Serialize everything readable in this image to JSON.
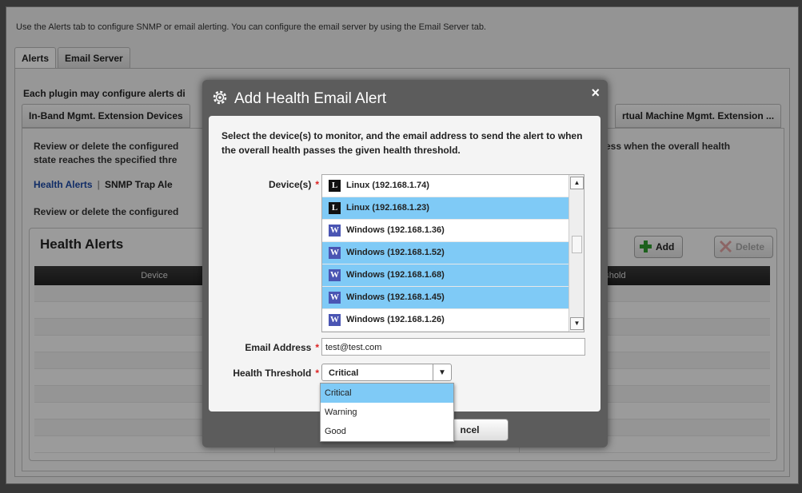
{
  "intro_text": "Use the Alerts tab to configure SNMP or email alerting.  You can configure the email server by using the Email Server tab.",
  "outer_tabs": [
    {
      "label": "Alerts"
    },
    {
      "label": "Email Server"
    }
  ],
  "plugin_text": "Each plugin may configure alerts di",
  "inner_tabs": [
    {
      "label": "In-Band Mgmt. Extension Devices"
    },
    {
      "label": "rtual Machine Mgmt. Extension ..."
    }
  ],
  "review_text_left": "Review or delete the configured",
  "review_text_left2": "state reaches the specified thre",
  "review_text_right": "ess when the overall health",
  "subtabs": {
    "health": "Health Alerts",
    "separator": "|",
    "snmp": "SNMP Trap Ale"
  },
  "review_text2": "Review or delete the configured",
  "grid": {
    "title": "Health Alerts",
    "add_label": "Add",
    "delete_label": "Delete",
    "columns": [
      "Device",
      "Health Threshold"
    ]
  },
  "dialog": {
    "title": "Add Health Email Alert",
    "close": "×",
    "instructions": "Select the device(s) to monitor, and the email address to send the alert to when the overall health passes the given health threshold.",
    "devices_label": "Device(s)",
    "required_mark": "*",
    "devices": [
      {
        "name": "Linux (192.168.1.74)",
        "os": "linux",
        "icon": "L",
        "selected": false
      },
      {
        "name": "Linux (192.168.1.23)",
        "os": "linux",
        "icon": "L",
        "selected": true
      },
      {
        "name": "Windows (192.168.1.36)",
        "os": "windows",
        "icon": "W",
        "selected": false
      },
      {
        "name": "Windows (192.168.1.52)",
        "os": "windows",
        "icon": "W",
        "selected": true
      },
      {
        "name": "Windows (192.168.1.68)",
        "os": "windows",
        "icon": "W",
        "selected": true
      },
      {
        "name": "Windows (192.168.1.45)",
        "os": "windows",
        "icon": "W",
        "selected": true
      },
      {
        "name": "Windows (192.168.1.26)",
        "os": "windows",
        "icon": "W",
        "selected": false
      }
    ],
    "email_label": "Email Address",
    "email_value": "test@test.com",
    "threshold_label": "Health Threshold",
    "threshold_value": "Critical",
    "threshold_options": [
      {
        "label": "Critical",
        "selected": true
      },
      {
        "label": "Warning",
        "selected": false
      },
      {
        "label": "Good",
        "selected": false
      }
    ],
    "cancel_label": "ncel"
  },
  "colors": {
    "selection": "#7fcaf6",
    "link": "#1c4aa6",
    "required": "#dd2222",
    "dialog_frame": "#5c5c5c"
  }
}
